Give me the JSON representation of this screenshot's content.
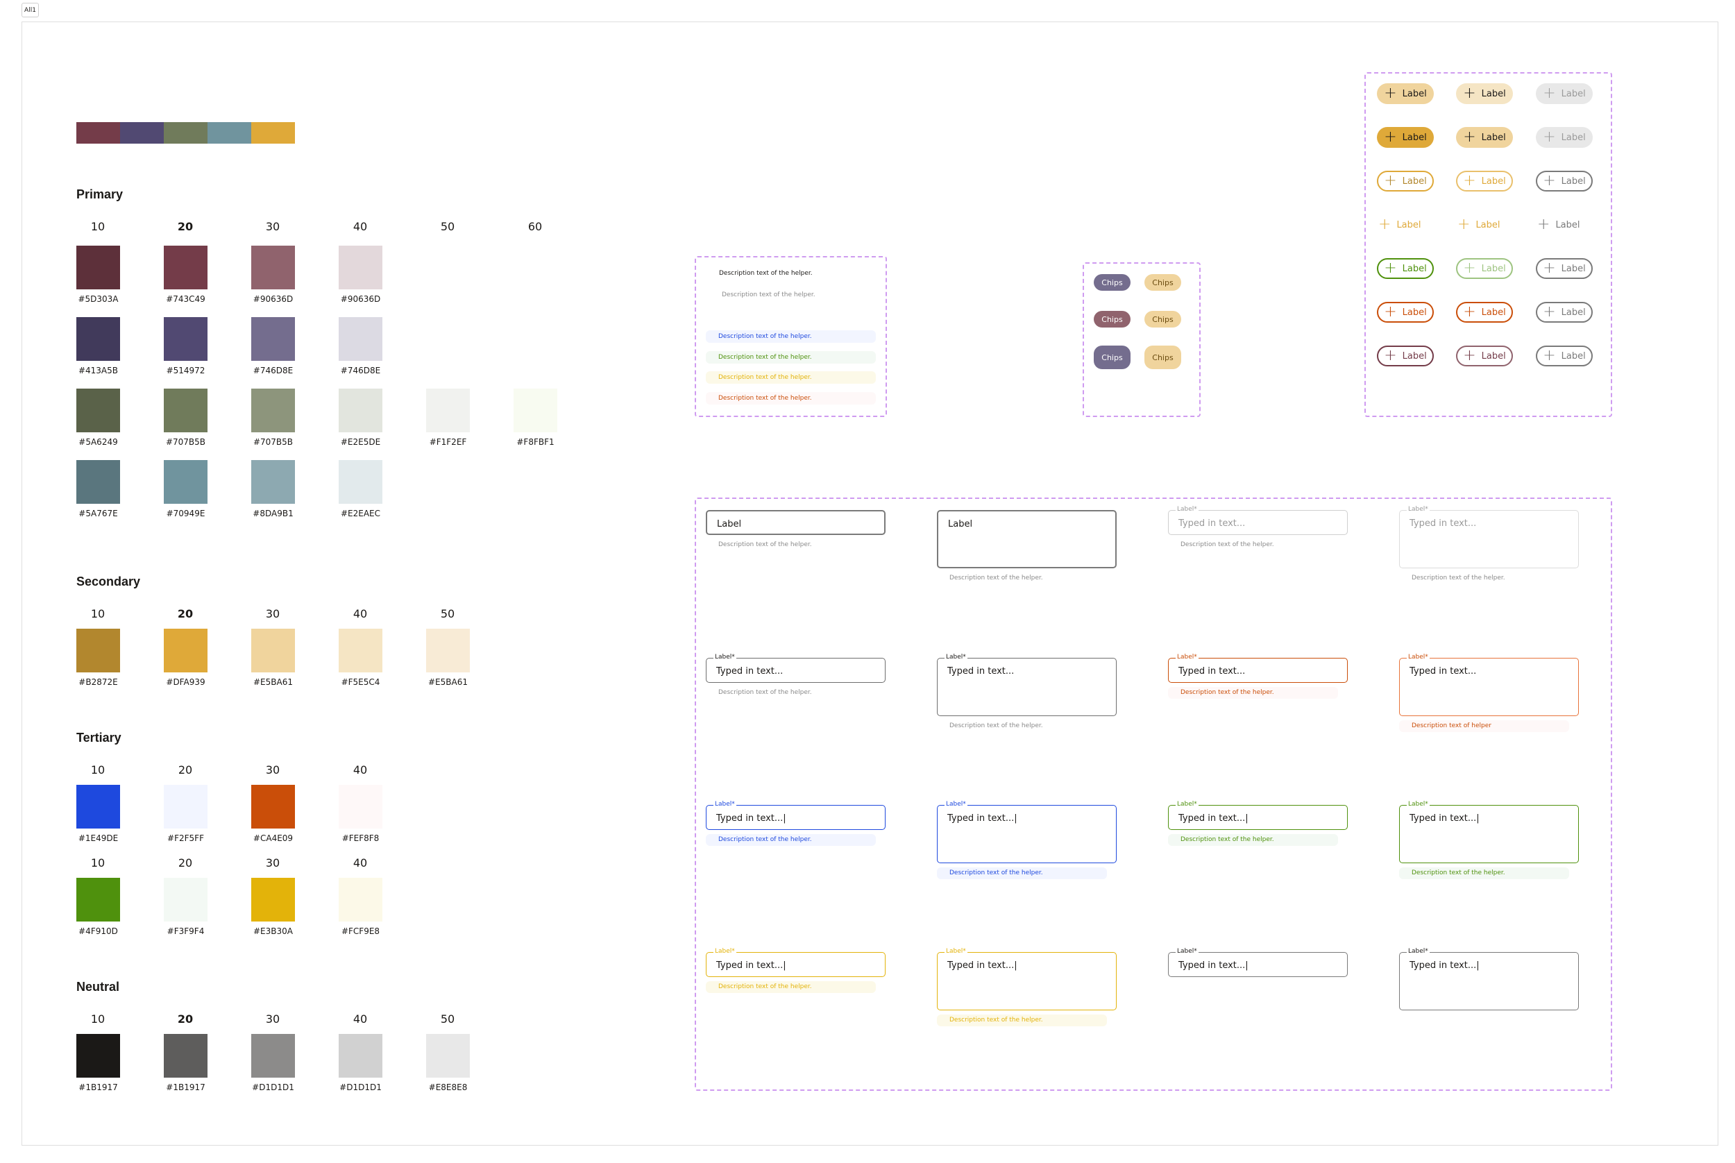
{
  "tab_label": "All1",
  "strip_colors": [
    "#743C49",
    "#514972",
    "#707B5B",
    "#70949E",
    "#DFA939"
  ],
  "primary": {
    "title": "Primary",
    "headers": [
      "10",
      "20",
      "30",
      "40",
      "50",
      "60"
    ],
    "bold_header": 1,
    "rows": [
      [
        {
          "color": "#5D303A",
          "hex": "#5D303A"
        },
        {
          "color": "#743C49",
          "hex": "#743C49"
        },
        {
          "color": "#90636D",
          "hex": "#90636D"
        },
        {
          "color": "#E3D8DB",
          "hex": "#90636D"
        }
      ],
      [
        {
          "color": "#413A5B",
          "hex": "#413A5B"
        },
        {
          "color": "#514972",
          "hex": "#514972"
        },
        {
          "color": "#746D8E",
          "hex": "#746D8E"
        },
        {
          "color": "#DCDAE3",
          "hex": "#746D8E"
        }
      ],
      [
        {
          "color": "#5A6249",
          "hex": "#5A6249"
        },
        {
          "color": "#707B5B",
          "hex": "#707B5B"
        },
        {
          "color": "#8D957C",
          "hex": "#707B5B"
        },
        {
          "color": "#E2E5DE",
          "hex": "#E2E5DE"
        },
        {
          "color": "#F1F2EF",
          "hex": "#F1F2EF"
        },
        {
          "color": "#F8FBF1",
          "hex": "#F8FBF1"
        }
      ],
      [
        {
          "color": "#5A767E",
          "hex": "#5A767E"
        },
        {
          "color": "#70949E",
          "hex": "#70949E"
        },
        {
          "color": "#8DA9B1",
          "hex": "#8DA9B1"
        },
        {
          "color": "#E2EAEC",
          "hex": "#E2EAEC"
        }
      ]
    ]
  },
  "secondary": {
    "title": "Secondary",
    "headers": [
      "10",
      "20",
      "30",
      "40",
      "50"
    ],
    "bold_header": 1,
    "rows": [
      [
        {
          "color": "#B2872E",
          "hex": "#B2872E"
        },
        {
          "color": "#DFA939",
          "hex": "#DFA939"
        },
        {
          "color": "#E5BA61",
          "hex": "#E5BA61",
          "fill": "#F0D49D"
        },
        {
          "color": "#F5E5C4",
          "hex": "#F5E5C4"
        },
        {
          "color": "#F8EBD6",
          "hex": "#E5BA61"
        }
      ]
    ]
  },
  "tertiary": {
    "title": "Tertiary",
    "headers1": [
      "10",
      "20",
      "30",
      "40"
    ],
    "headers2": [
      "10",
      "20",
      "30",
      "40"
    ],
    "row1": [
      {
        "color": "#1E49DE",
        "hex": "#1E49DE"
      },
      {
        "color": "#F2F5FF",
        "hex": "#F2F5FF"
      },
      {
        "color": "#CA4E09",
        "hex": "#CA4E09"
      },
      {
        "color": "#FEF8F8",
        "hex": "#FEF8F8"
      }
    ],
    "row2": [
      {
        "color": "#4F910D",
        "hex": "#4F910D"
      },
      {
        "color": "#F3F9F4",
        "hex": "#F3F9F4"
      },
      {
        "color": "#E3B30A",
        "hex": "#E3B30A"
      },
      {
        "color": "#FCF9E8",
        "hex": "#FCF9E8"
      }
    ]
  },
  "neutral": {
    "title": "Neutral",
    "headers": [
      "10",
      "20",
      "30",
      "40",
      "50"
    ],
    "bold_header": 1,
    "row": [
      {
        "color": "#1B1917",
        "hex": "#1B1917"
      },
      {
        "color": "#5E5D5C",
        "hex": "#1B1917"
      },
      {
        "color": "#8C8B8A",
        "hex": "#D1D1D1"
      },
      {
        "color": "#D1D1D1",
        "hex": "#D1D1D1"
      },
      {
        "color": "#E8E8E8",
        "hex": "#E8E8E8"
      }
    ]
  },
  "helpers": {
    "dark": "Description text of the helper.",
    "light": "Description text of the helper.",
    "blue": "Description text of the helper.",
    "green": "Description text of the helper.",
    "yellow": "Description text of the helper.",
    "red": "Description text of the helper."
  },
  "chips": {
    "label": "Chips"
  },
  "buttons": {
    "label": "Label"
  },
  "fields": {
    "label": "Label",
    "required_label": "Label",
    "asterisk": "*",
    "placeholder": "Typed in text...",
    "typed": "Typed in text...|",
    "helper": "Description text of the helper.",
    "helper_alt": "Description text of helper"
  }
}
